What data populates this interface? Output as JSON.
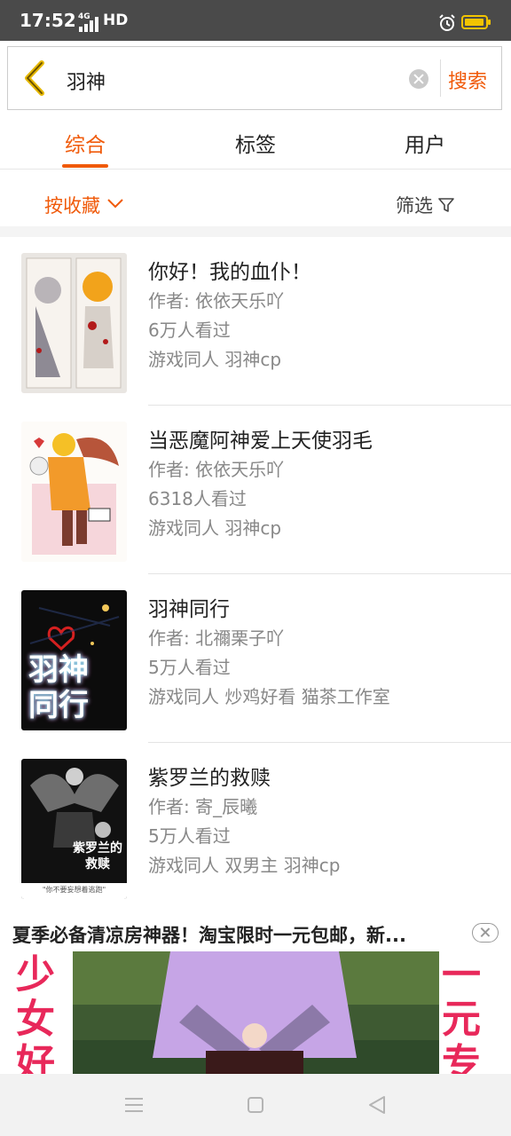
{
  "status_bar": {
    "time": "17:52",
    "network": "4G",
    "hd": "HD",
    "icons": [
      "signal-icon",
      "alarm-icon",
      "battery-icon"
    ],
    "battery_color": "#f2c400"
  },
  "search": {
    "back_icon": "chevron-left-icon",
    "query": "羽神",
    "clear_icon": "clear-icon",
    "submit_label": "搜索"
  },
  "tabs": [
    {
      "label": "综合",
      "active": true
    },
    {
      "label": "标签",
      "active": false
    },
    {
      "label": "用户",
      "active": false
    }
  ],
  "sort": {
    "label": "按收藏",
    "filter_label": "筛选",
    "accent": "#f05a0a"
  },
  "results": [
    {
      "title": "你好！我的血仆！",
      "author": "作者: 依依天乐吖",
      "views": "6万人看过",
      "tags": "游戏同人 羽神cp"
    },
    {
      "title": "当恶魔阿神爱上天使羽毛",
      "author": "作者: 依依天乐吖",
      "views": "6318人看过",
      "tags": "游戏同人 羽神cp"
    },
    {
      "title": "羽神同行",
      "author": "作者: 北禰栗子吖",
      "views": "5万人看过",
      "tags": "游戏同人 炒鸡好看 猫茶工作室",
      "cover_text": "羽神同行"
    },
    {
      "title": "紫罗兰的救赎",
      "author": "作者: 寄_辰曦",
      "views": "5万人看过",
      "tags": "游戏同人 双男主 羽神cp",
      "cover_text": "紫罗兰的救赎",
      "cover_caption": "\"你不要妄想着逃跑\""
    }
  ],
  "ad": {
    "title": "夏季必备清凉房神器！淘宝限时一元包邮，新...",
    "banner_left": "少女好",
    "banner_right": "一元专"
  },
  "nav_bar": {
    "icons": [
      "menu-icon",
      "home-icon",
      "back-icon"
    ]
  }
}
